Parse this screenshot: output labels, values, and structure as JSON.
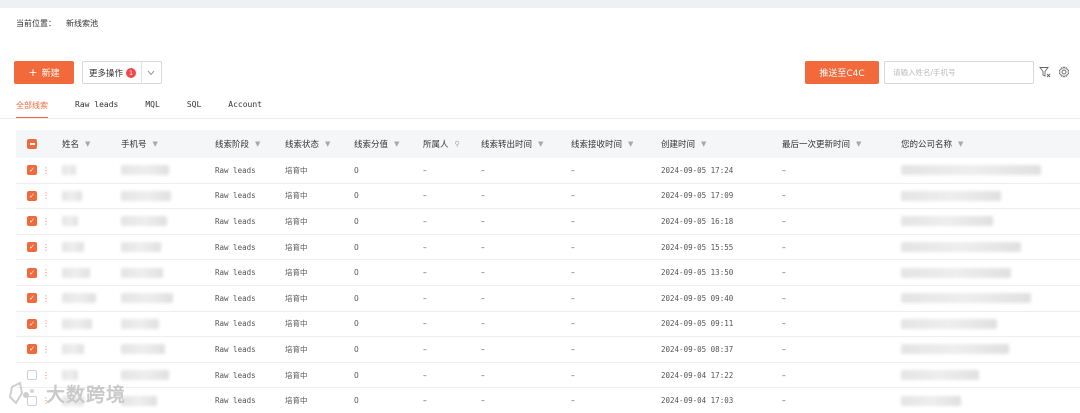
{
  "breadcrumb": {
    "label": "当前位置：",
    "current": "新线索池"
  },
  "toolbar": {
    "new_label": "新建",
    "more_label": "更多操作",
    "more_badge": "1",
    "push_label": "推送至C4C",
    "search_placeholder": "请输入姓名/手机号"
  },
  "tabs": [
    "全部线索",
    "Raw leads",
    "MQL",
    "SQL",
    "Account"
  ],
  "columns": [
    "姓名",
    "手机号",
    "线索阶段",
    "线索状态",
    "线索分值",
    "所属人",
    "线索转出时间",
    "线索接收时间",
    "创建时间",
    "最后一次更新时间",
    "您的公司名称"
  ],
  "rows": [
    {
      "stage": "Raw leads",
      "status": "培育中",
      "score": "0",
      "owner": "–",
      "out_time": "–",
      "in_time": "–",
      "created": "2024-09-05 17:24",
      "updated": "–",
      "checked": true
    },
    {
      "stage": "Raw leads",
      "status": "培育中",
      "score": "0",
      "owner": "–",
      "out_time": "–",
      "in_time": "–",
      "created": "2024-09-05 17:09",
      "updated": "–",
      "checked": true
    },
    {
      "stage": "Raw leads",
      "status": "培育中",
      "score": "0",
      "owner": "–",
      "out_time": "–",
      "in_time": "–",
      "created": "2024-09-05 16:18",
      "updated": "–",
      "checked": true
    },
    {
      "stage": "Raw leads",
      "status": "培育中",
      "score": "0",
      "owner": "–",
      "out_time": "–",
      "in_time": "–",
      "created": "2024-09-05 15:55",
      "updated": "–",
      "checked": true
    },
    {
      "stage": "Raw leads",
      "status": "培育中",
      "score": "0",
      "owner": "–",
      "out_time": "–",
      "in_time": "–",
      "created": "2024-09-05 13:50",
      "updated": "–",
      "checked": true
    },
    {
      "stage": "Raw leads",
      "status": "培育中",
      "score": "0",
      "owner": "–",
      "out_time": "–",
      "in_time": "–",
      "created": "2024-09-05 09:40",
      "updated": "–",
      "checked": true
    },
    {
      "stage": "Raw leads",
      "status": "培育中",
      "score": "0",
      "owner": "–",
      "out_time": "–",
      "in_time": "–",
      "created": "2024-09-05 09:11",
      "updated": "–",
      "checked": true
    },
    {
      "stage": "Raw leads",
      "status": "培育中",
      "score": "0",
      "owner": "–",
      "out_time": "–",
      "in_time": "–",
      "created": "2024-09-05 08:37",
      "updated": "–",
      "checked": true
    },
    {
      "stage": "Raw leads",
      "status": "培育中",
      "score": "0",
      "owner": "–",
      "out_time": "–",
      "in_time": "–",
      "created": "2024-09-04 17:22",
      "updated": "–",
      "checked": false
    },
    {
      "stage": "Raw leads",
      "status": "培育中",
      "score": "0",
      "owner": "–",
      "out_time": "–",
      "in_time": "–",
      "created": "2024-09-04 17:03",
      "updated": "–",
      "checked": false
    }
  ],
  "watermark": "大数跨境",
  "colors": {
    "accent": "#f26a3c",
    "badge": "#f04848",
    "header_bg": "#f5f6f8"
  }
}
